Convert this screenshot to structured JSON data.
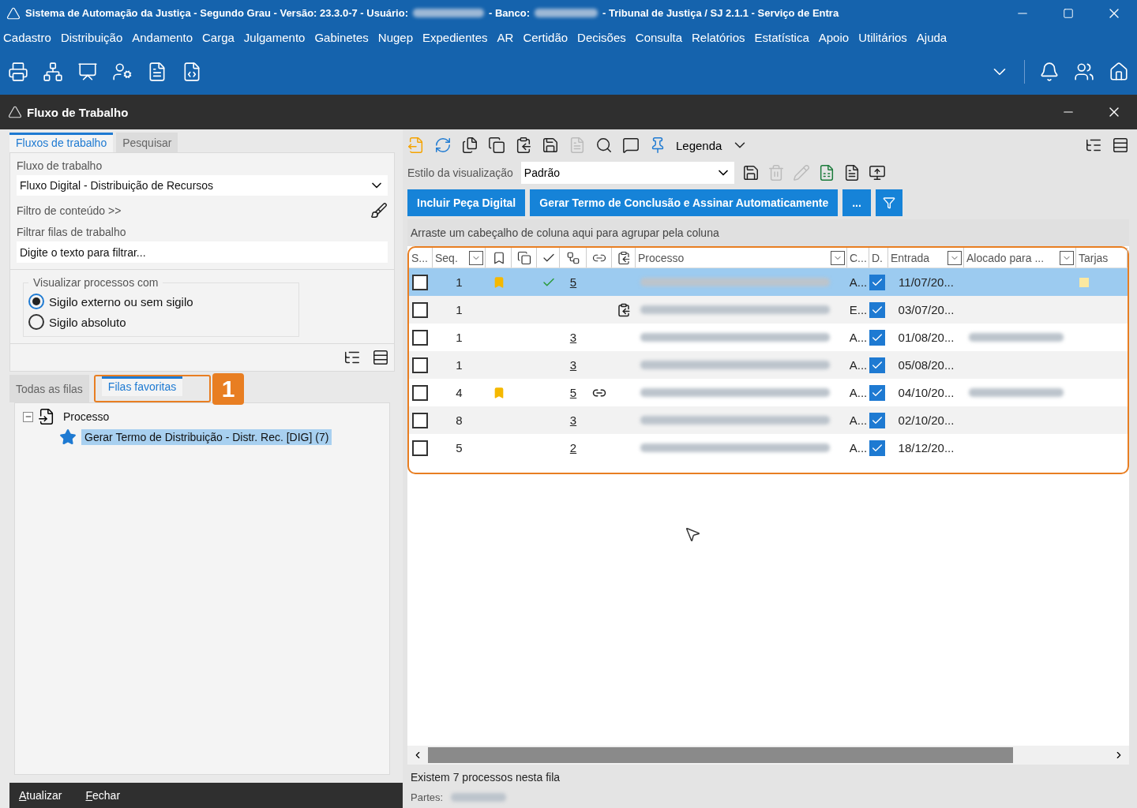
{
  "window": {
    "title_parts": [
      "Sistema de Automação da Justiça - Segundo Grau - Versão: 23.3.0-7 - Usuário:",
      "- Banco:",
      "- Tribunal de Justiça / SJ 2.1.1 - Serviço de Entra"
    ]
  },
  "menu": [
    "Cadastro",
    "Distribuição",
    "Andamento",
    "Carga",
    "Julgamento",
    "Gabinetes",
    "Nugep",
    "Expedientes",
    "AR",
    "Certidão",
    "Decisões",
    "Consulta",
    "Relatórios",
    "Estatística",
    "Apoio",
    "Utilitários",
    "Ajuda"
  ],
  "panel": {
    "title": "Fluxo de Trabalho"
  },
  "left": {
    "tabs": [
      {
        "label": "Fluxos de trabalho",
        "selected": true
      },
      {
        "label": "Pesquisar",
        "selected": false
      }
    ],
    "workflow_label": "Fluxo de trabalho",
    "workflow_value": "Fluxo Digital - Distribuição de Recursos",
    "content_filter": "Filtro de conteúdo >>",
    "queue_filter_label": "Filtrar filas de trabalho",
    "queue_filter_placeholder": "Digite o texto para filtrar...",
    "radio_group": {
      "title": "Visualizar processos com",
      "options": [
        {
          "label": "Sigilo externo ou sem sigilo",
          "selected": true
        },
        {
          "label": "Sigilo absoluto",
          "selected": false
        }
      ]
    },
    "queue_tabs": [
      {
        "label": "Todas as filas",
        "selected": false
      },
      {
        "label": "Filas favoritas",
        "selected": true
      }
    ],
    "annotation": "1",
    "tree": [
      {
        "label": "Processo",
        "expanded": true,
        "selected": false,
        "children": [
          {
            "label": "Gerar Termo de Distribuição - Distr. Rec. [DIG] (7)",
            "selected": true
          }
        ]
      }
    ],
    "footer_buttons": [
      "Atualizar",
      "Fechar"
    ]
  },
  "right": {
    "legend": "Legenda",
    "style_label": "Estilo da visualização",
    "style_value": "Padrão",
    "actions": [
      "Incluir Peça Digital",
      "Gerar Termo de Conclusão e Assinar Automaticamente",
      "..."
    ],
    "group_hint": "Arraste um cabeçalho de coluna aqui para agrupar pela coluna",
    "columns": [
      {
        "kind": "text",
        "label": "S...",
        "filter": false
      },
      {
        "kind": "text",
        "label": "Seq.",
        "filter": true
      },
      {
        "kind": "icon"
      },
      {
        "kind": "icon"
      },
      {
        "kind": "icon"
      },
      {
        "kind": "icon"
      },
      {
        "kind": "icon"
      },
      {
        "kind": "icon"
      },
      {
        "kind": "text",
        "label": "Processo",
        "filter": true
      },
      {
        "kind": "text",
        "label": "C...",
        "filter": false
      },
      {
        "kind": "text",
        "label": "D.",
        "filter": false
      },
      {
        "kind": "text",
        "label": "Entrada",
        "filter": true
      },
      {
        "kind": "text",
        "label": "Alocado para ...",
        "filter": true
      },
      {
        "kind": "text",
        "label": "Tarjas",
        "filter": false
      }
    ],
    "rows": [
      {
        "selected": true,
        "checked": false,
        "seq": "1",
        "flagged": true,
        "done": true,
        "count": "5",
        "linked": false,
        "attached": false,
        "c": "A...",
        "d": true,
        "entrada": "11/07/20...",
        "allocated": false,
        "tarja": true
      },
      {
        "selected": false,
        "checked": false,
        "seq": "1",
        "flagged": false,
        "done": false,
        "linked": false,
        "attached": true,
        "c": "E...",
        "d": true,
        "entrada": "03/07/20...",
        "allocated": false,
        "tarja": false
      },
      {
        "selected": false,
        "checked": false,
        "seq": "1",
        "flagged": false,
        "done": false,
        "count": "3",
        "linked": false,
        "attached": false,
        "c": "A...",
        "d": true,
        "entrada": "01/08/20...",
        "allocated": true,
        "tarja": false
      },
      {
        "selected": false,
        "checked": false,
        "seq": "1",
        "flagged": false,
        "done": false,
        "count": "3",
        "linked": false,
        "attached": false,
        "c": "A...",
        "d": true,
        "entrada": "05/08/20...",
        "allocated": false,
        "tarja": false
      },
      {
        "selected": false,
        "checked": false,
        "seq": "4",
        "flagged": true,
        "done": false,
        "count": "5",
        "linked": true,
        "attached": false,
        "c": "A...",
        "d": true,
        "entrada": "04/10/20...",
        "allocated": true,
        "tarja": false
      },
      {
        "selected": false,
        "checked": false,
        "seq": "8",
        "flagged": false,
        "done": false,
        "count": "3",
        "linked": false,
        "attached": false,
        "c": "A...",
        "d": true,
        "entrada": "02/10/20...",
        "allocated": false,
        "tarja": false
      },
      {
        "selected": false,
        "checked": false,
        "seq": "5",
        "flagged": false,
        "done": false,
        "count": "2",
        "linked": false,
        "attached": false,
        "c": "A...",
        "d": true,
        "entrada": "18/12/20...",
        "allocated": false,
        "tarja": false
      }
    ],
    "status": "Existem 7 processos nesta fila",
    "parties_label": "Partes:"
  }
}
